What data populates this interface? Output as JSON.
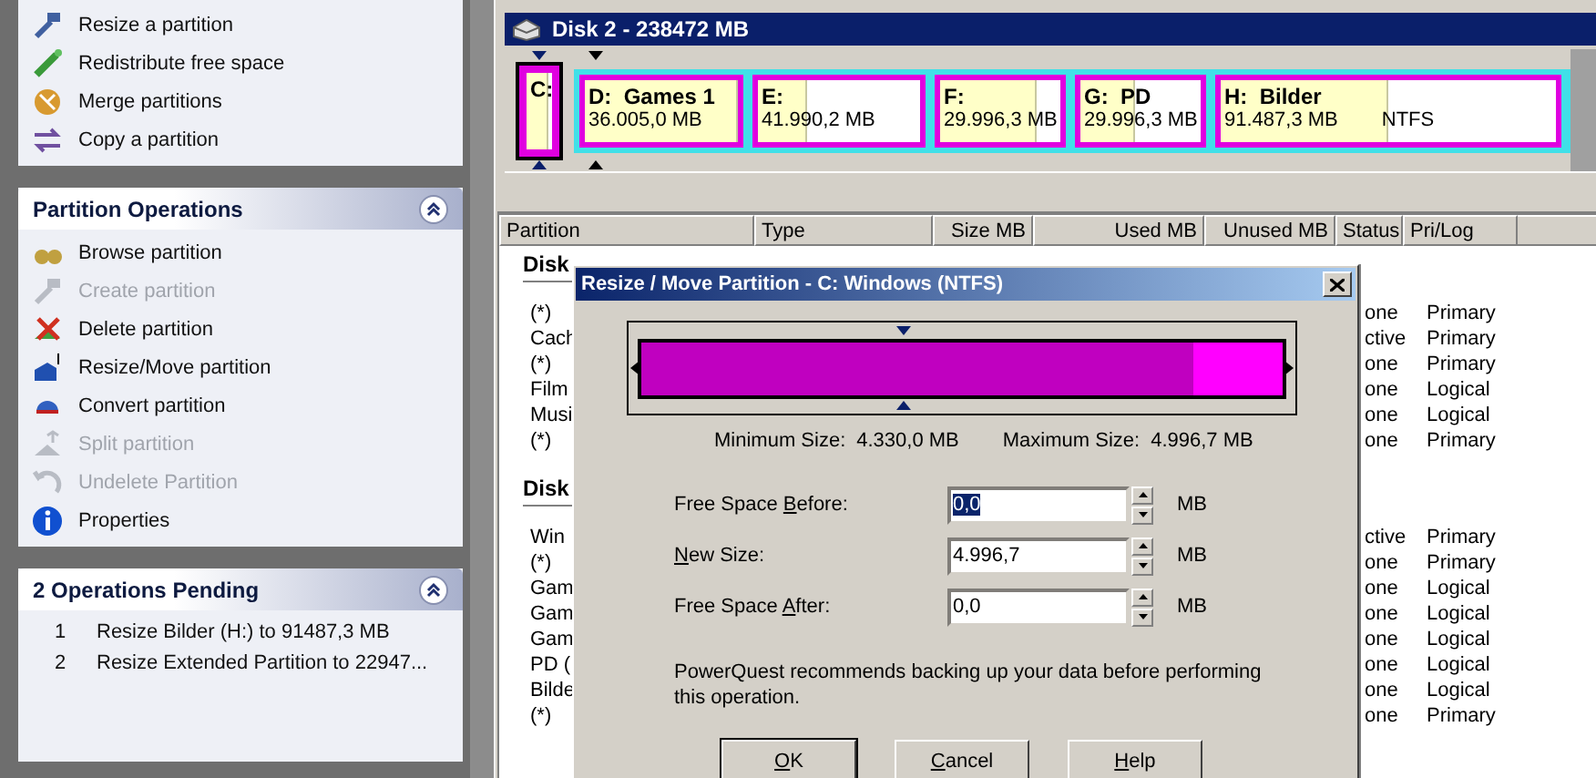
{
  "sidebar": {
    "panels": [
      {
        "items": [
          {
            "label": "Resize a partition",
            "disabled": false
          },
          {
            "label": "Redistribute free space",
            "disabled": false
          },
          {
            "label": "Merge partitions",
            "disabled": false
          },
          {
            "label": "Copy a partition",
            "disabled": false
          }
        ]
      },
      {
        "title": "Partition Operations",
        "expanded": true,
        "items": [
          {
            "label": "Browse partition",
            "disabled": false
          },
          {
            "label": "Create partition",
            "disabled": true
          },
          {
            "label": "Delete partition",
            "disabled": false
          },
          {
            "label": "Resize/Move partition",
            "disabled": false
          },
          {
            "label": "Convert partition",
            "disabled": false
          },
          {
            "label": "Split partition",
            "disabled": true
          },
          {
            "label": "Undelete Partition",
            "disabled": true
          },
          {
            "label": "Properties",
            "disabled": false
          }
        ]
      }
    ],
    "pending": {
      "title": "2 Operations Pending",
      "expanded": true,
      "items": [
        {
          "number": "1",
          "text": "Resize Bilder (H:) to 91487,3 MB"
        },
        {
          "number": "2",
          "text": "Resize Extended Partition to 22947..."
        }
      ]
    }
  },
  "disk_map": {
    "title": "Disk 2 - 238472 MB",
    "partitions": [
      {
        "letter": "C:",
        "selected": true,
        "level": 0.85
      }
    ],
    "extended": [
      {
        "letter": "D:",
        "label": "Games 1",
        "size": "36.005,0 MB",
        "selected": false,
        "level": 1.0
      },
      {
        "letter": "E:",
        "size": "41.990,2 MB",
        "selected": false,
        "level": 0.3
      },
      {
        "letter": "F:",
        "size": "29.996,3 MB",
        "selected": false,
        "level": 0.8
      },
      {
        "letter": "G:",
        "label": "PD",
        "size": "29.996,3 MB",
        "selected": false,
        "level": 0.45
      },
      {
        "letter": "H:",
        "label": "Bilder",
        "size": "91.487,3 MB",
        "fs": "NTFS",
        "selected": false,
        "level": 0.5
      }
    ]
  },
  "table": {
    "columns": [
      "Partition",
      "Type",
      "Size MB",
      "Used MB",
      "Unused MB",
      "Status",
      "Pri/Log"
    ],
    "groups": [
      {
        "title": "Disk",
        "rows": [
          {
            "partition": "(*)",
            "status": "one",
            "prilog": "Primary"
          },
          {
            "partition": "Cach",
            "status": "ctive",
            "prilog": "Primary"
          },
          {
            "partition": "(*)",
            "status": "one",
            "prilog": "Primary"
          },
          {
            "partition": "Film",
            "status": "one",
            "prilog": "Logical"
          },
          {
            "partition": "Musi",
            "status": "one",
            "prilog": "Logical"
          },
          {
            "partition": "(*)",
            "status": "one",
            "prilog": "Primary"
          }
        ]
      },
      {
        "title": "Disk",
        "rows": [
          {
            "partition": "Win",
            "status": "ctive",
            "prilog": "Primary"
          },
          {
            "partition": "(*)",
            "status": "one",
            "prilog": "Primary"
          },
          {
            "partition": "Gam",
            "status": "one",
            "prilog": "Logical"
          },
          {
            "partition": "Gam",
            "status": "one",
            "prilog": "Logical"
          },
          {
            "partition": "Gam",
            "status": "one",
            "prilog": "Logical"
          },
          {
            "partition": "PD (",
            "status": "one",
            "prilog": "Logical"
          },
          {
            "partition": "Bilde",
            "status": "one",
            "prilog": "Logical"
          },
          {
            "partition": "(*)",
            "status": "one",
            "prilog": "Primary"
          }
        ]
      }
    ]
  },
  "dialog": {
    "title": "Resize / Move Partition - C: Windows (NTFS)",
    "bar": {
      "level": 0.86
    },
    "min_label": "Minimum Size:",
    "min_value": "4.330,0 MB",
    "max_label": "Maximum Size:",
    "max_value": "4.996,7 MB",
    "fields": [
      {
        "label": {
          "pre": "Free Space ",
          "key": "B",
          "post": "efore:"
        },
        "value": "0,0",
        "selected": true,
        "unit": "MB"
      },
      {
        "label": {
          "key": "N",
          "post": "ew Size:"
        },
        "value": "4.996,7",
        "selected": false,
        "unit": "MB"
      },
      {
        "label": {
          "pre": "Free Space ",
          "key": "A",
          "post": "fter:"
        },
        "value": "0,0",
        "selected": false,
        "unit": "MB"
      }
    ],
    "message": "PowerQuest recommends backing up your data before performing this operation.",
    "buttons": [
      {
        "key": "O",
        "post": "K"
      },
      {
        "key": "C",
        "post": "ancel"
      },
      {
        "key": "H",
        "post": "elp"
      }
    ]
  }
}
